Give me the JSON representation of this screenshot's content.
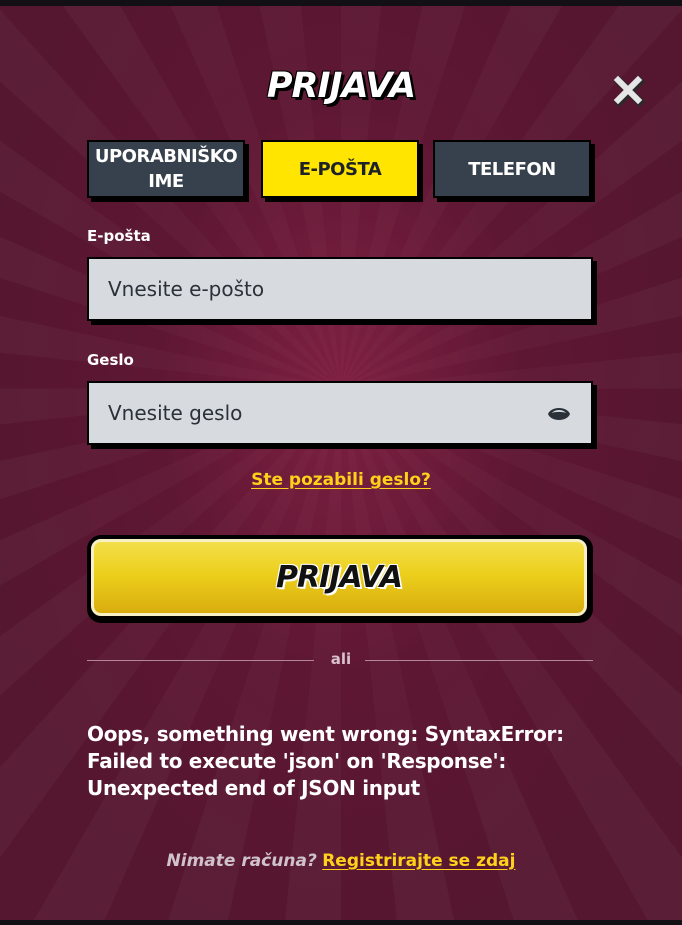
{
  "modal": {
    "title": "PRIJAVA",
    "close_icon": "close-icon"
  },
  "tabs": [
    {
      "line1": "UPORABNIŠKO",
      "line2": "IME",
      "active": false
    },
    {
      "line1": "E-POŠTA",
      "line2": "",
      "active": true
    },
    {
      "line1": "TELEFON",
      "line2": "",
      "active": false
    }
  ],
  "email": {
    "label": "E-pošta",
    "placeholder": "Vnesite e-pošto",
    "value": ""
  },
  "password": {
    "label": "Geslo",
    "placeholder": "Vnesite geslo",
    "value": "",
    "toggle_icon": "eye-icon"
  },
  "forgot_link": "Ste pozabili geslo?",
  "login_button": "PRIJAVA",
  "divider": "ali",
  "error_message": "Oops, something went wrong: SyntaxError: Failed to execute 'json' on 'Response': Unexpected end of JSON input",
  "signup": {
    "question": "Nimate računa?",
    "link": "Registrirajte se zdaj"
  },
  "colors": {
    "background": "#551630",
    "accent_yellow": "#ffe500",
    "tab_dark": "#36414d",
    "input_bg": "#d7dbe0",
    "link_yellow": "#ffd11a"
  }
}
